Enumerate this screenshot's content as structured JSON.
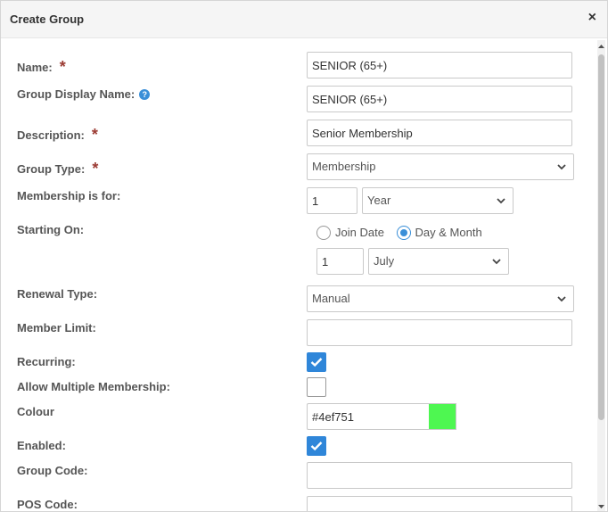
{
  "dialog": {
    "title": "Create Group",
    "close_glyph": "×"
  },
  "fields": {
    "name": {
      "label": "Name:",
      "required": "*",
      "value": "SENIOR (65+)"
    },
    "display_name": {
      "label": "Group Display Name:",
      "help_icon": "?",
      "value": "SENIOR (65+)"
    },
    "description": {
      "label": "Description:",
      "required": "*",
      "value": "Senior Membership"
    },
    "group_type": {
      "label": "Group Type:",
      "required": "*",
      "value": "Membership"
    },
    "membership_for": {
      "label": "Membership is for:",
      "count": "1",
      "unit": "Year"
    },
    "starting_on": {
      "label": "Starting On:",
      "options": [
        "Join Date",
        "Day & Month"
      ],
      "selected": "Day & Month",
      "day": "1",
      "month": "July"
    },
    "renewal_type": {
      "label": "Renewal Type:",
      "value": "Manual"
    },
    "member_limit": {
      "label": "Member Limit:",
      "value": ""
    },
    "recurring": {
      "label": "Recurring:",
      "checked": true
    },
    "allow_multiple": {
      "label": "Allow Multiple Membership:",
      "checked": false
    },
    "colour": {
      "label": "Colour",
      "value": "#4ef751",
      "swatch": "#4ef751"
    },
    "enabled": {
      "label": "Enabled:",
      "checked": true
    },
    "group_code": {
      "label": "Group Code:",
      "value": ""
    },
    "pos_code": {
      "label": "POS Code:",
      "value": ""
    }
  },
  "icons": {
    "close": "close-icon",
    "help": "help-icon",
    "dropdown": "chevron-down-icon",
    "check": "checkmark-icon"
  },
  "colors": {
    "accent": "#2f86d9",
    "required": "#9b3b33",
    "header_bg": "#f5f5f5"
  }
}
